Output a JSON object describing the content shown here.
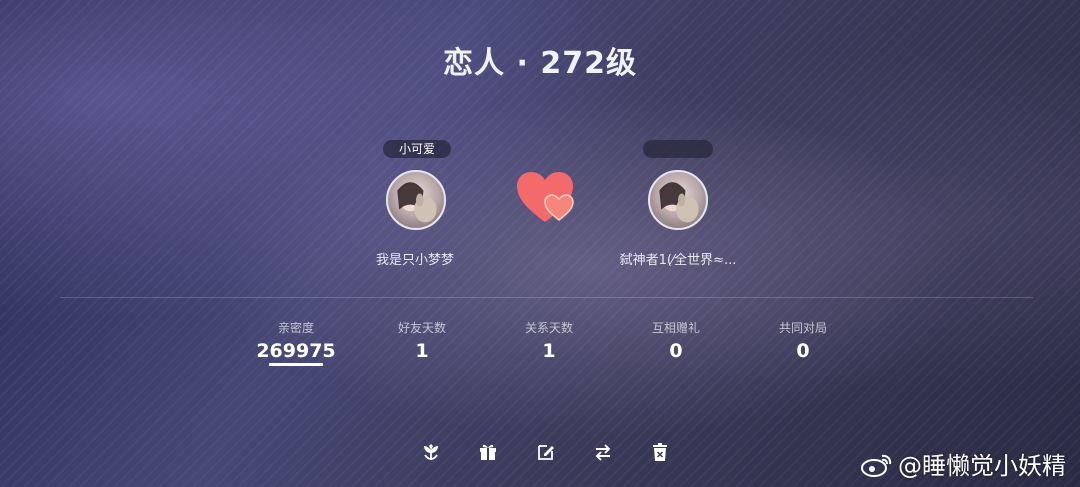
{
  "header": {
    "title": "恋人 · 272级"
  },
  "left_user": {
    "tag": "小可爱",
    "nickname": "我是只小梦梦"
  },
  "right_user": {
    "tag": "",
    "nickname": "弑神者1(⁄全世界≈..."
  },
  "stats": [
    {
      "label": "亲密度",
      "value": "269975"
    },
    {
      "label": "好友天数",
      "value": "1"
    },
    {
      "label": "关系天数",
      "value": "1"
    },
    {
      "label": "互相赠礼",
      "value": "0"
    },
    {
      "label": "共同对局",
      "value": "0"
    }
  ],
  "toolbar": {
    "icons": [
      "flower-icon",
      "gift-icon",
      "edit-icon",
      "swap-icon",
      "delete-icon"
    ]
  },
  "watermark": {
    "text": "@睡懒觉小妖精"
  },
  "colors": {
    "heart_main": "#f26a6a",
    "heart_accent": "#ff9a8a",
    "accent": "#ffffff"
  }
}
